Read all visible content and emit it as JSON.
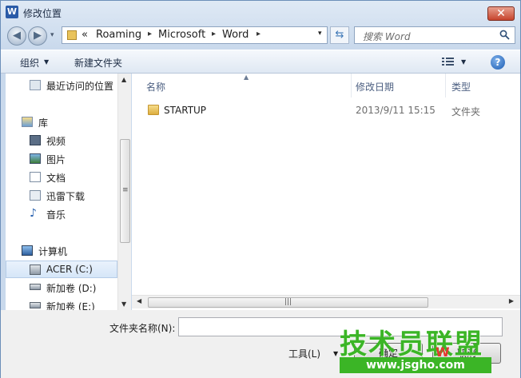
{
  "window": {
    "title": "修改位置",
    "close": "✕",
    "app_icon": "W"
  },
  "nav": {
    "back": "◀",
    "forward": "▶",
    "dropdown": "▾",
    "refresh": "⇆"
  },
  "address": {
    "overflow": "«",
    "crumbs": [
      "Roaming",
      "Microsoft",
      "Word"
    ],
    "sep": "▸",
    "dropdown": "▾"
  },
  "search": {
    "placeholder": "搜索 Word"
  },
  "toolbar": {
    "organize": "组织",
    "new_folder": "新建文件夹",
    "help": "?"
  },
  "sidebar": {
    "items": [
      {
        "label": "最近访问的位置",
        "icon": "recent-places-icon"
      },
      {
        "label": "库",
        "icon": "libraries-icon"
      },
      {
        "label": "视频",
        "icon": "videos-icon"
      },
      {
        "label": "图片",
        "icon": "pictures-icon"
      },
      {
        "label": "文档",
        "icon": "documents-icon"
      },
      {
        "label": "迅雷下载",
        "icon": "thunder-download-icon"
      },
      {
        "label": "音乐",
        "icon": "music-icon"
      },
      {
        "label": "计算机",
        "icon": "computer-icon"
      },
      {
        "label": "ACER (C:)",
        "icon": "drive-c-icon"
      },
      {
        "label": "新加卷 (D:)",
        "icon": "drive-d-icon"
      },
      {
        "label": "新加卷 (E:)",
        "icon": "drive-e-icon"
      }
    ]
  },
  "columns": {
    "name": "名称",
    "date": "修改日期",
    "type": "类型"
  },
  "files": [
    {
      "name": "STARTUP",
      "date": "2013/9/11 15:15",
      "type": "文件夹"
    }
  ],
  "footer": {
    "folder_name_label": "文件夹名称(N):",
    "folder_name_value": "",
    "tools": "工具(L)",
    "ok": "确定",
    "cancel": "取消"
  },
  "watermark": {
    "top": "技术员联盟",
    "bottom": "www.jsgho.com",
    "logo": "W"
  }
}
